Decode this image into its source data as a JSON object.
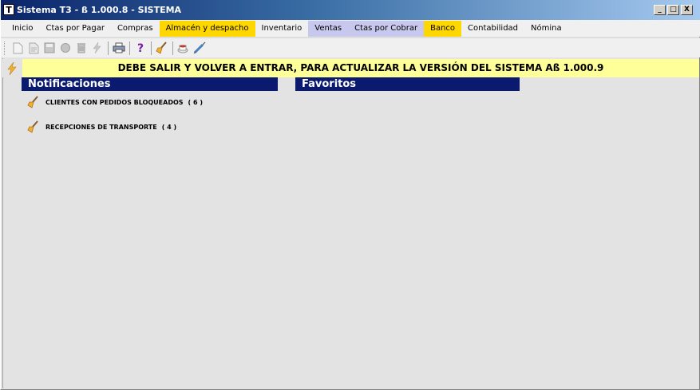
{
  "window": {
    "title": "Sistema T3 - ß 1.000.8 - SISTEMA",
    "icon_glyph": "T",
    "minimize": "_",
    "maximize": "□",
    "close": "X"
  },
  "menu": {
    "items": [
      {
        "label": "Inicio",
        "bg": "#f0f0f0"
      },
      {
        "label": "Ctas por Pagar",
        "bg": "#f0f0f0"
      },
      {
        "label": "Compras",
        "bg": "#f0f0f0"
      },
      {
        "label": "Almacén y despacho",
        "bg": "#ffd700"
      },
      {
        "label": "Inventario",
        "bg": "#f0f0f0"
      },
      {
        "label": "Ventas",
        "bg": "#c8c8ef"
      },
      {
        "label": "Ctas por Cobrar",
        "bg": "#c8c8ef"
      },
      {
        "label": "Banco",
        "bg": "#ffd700"
      },
      {
        "label": "Contabilidad",
        "bg": "#f0f0f0"
      },
      {
        "label": "Nómina",
        "bg": "#f0f0f0"
      }
    ]
  },
  "toolbar": {
    "icons": [
      "new-document-icon",
      "open-document-icon",
      "save-icon",
      "record-icon",
      "trash-icon",
      "lightning-icon",
      "print-icon",
      "help-icon",
      "broom-icon",
      "coffee-icon",
      "syringe-icon"
    ]
  },
  "alert": {
    "message": "DEBE SALIR Y VOLVER A ENTRAR, PARA ACTUALIZAR LA VERSIÓN DEL SISTEMA Aß 1.000.9",
    "icon": "lightning-icon",
    "color": "#ffff99"
  },
  "notifications": {
    "title": "Notificaciones",
    "items": [
      {
        "label": "CLIENTES CON PEDIDOS BLOQUEADOS",
        "count": "( 6 )",
        "icon": "broom-icon"
      },
      {
        "label": "RECEPCIONES DE TRANSPORTE",
        "count": "( 4 )",
        "icon": "broom-icon"
      }
    ]
  },
  "favorites": {
    "title": "Favoritos"
  },
  "colors": {
    "header_bg": "#0a1a6e",
    "title_gradient_start": "#0a246a",
    "highlight_yellow": "#ffd700",
    "highlight_lavender": "#c8c8ef"
  }
}
